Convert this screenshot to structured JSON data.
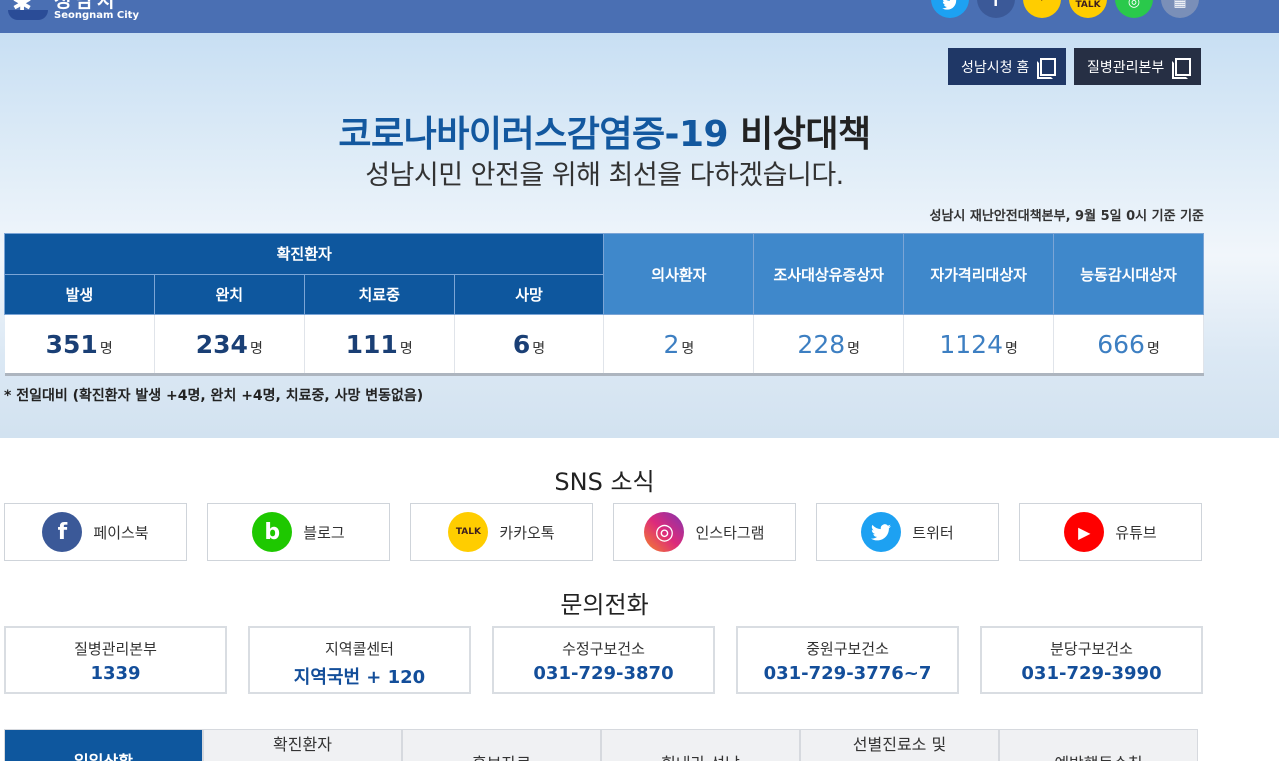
{
  "header": {
    "logo_ko": "성남시",
    "logo_en": "Seongnam City",
    "social_icons": [
      {
        "name": "twitter-icon",
        "glyph": "",
        "color": "#1da1f2"
      },
      {
        "name": "facebook-icon",
        "glyph": "f",
        "color": "#3b5998"
      },
      {
        "name": "kakaostory-icon",
        "glyph": "",
        "color": "#ffcd00"
      },
      {
        "name": "kakaotalk-icon",
        "glyph": "TALK",
        "color": "#ffcd00"
      },
      {
        "name": "band-icon",
        "glyph": "",
        "color": "#2ac94b"
      },
      {
        "name": "qrcode-icon",
        "glyph": "",
        "color": "#7a8fb8"
      }
    ]
  },
  "hero": {
    "btn_city_home": "성남시청 홈",
    "btn_kdca": "질병관리본부",
    "title_blue": "코로나바이러스감염증-19",
    "title_dark": "비상대책",
    "subtitle": "성남시민 안전을 위해 최선을 다하겠습니다.",
    "basis": "성남시 재난안전대책본부, 9월 5일 0시 기준 기준",
    "note": "* 전일대비 (확진환자 발생 +4명, 완치 +4명, 치료중, 사망 변동없음)"
  },
  "stats": {
    "confirmed_header": "확진환자",
    "sub_headers": [
      "발생",
      "완치",
      "치료중",
      "사망"
    ],
    "other_headers": [
      "의사환자",
      "조사대상유증상자",
      "자가격리대상자",
      "능동감시대상자"
    ],
    "confirmed_values": [
      "351",
      "234",
      "111",
      "6"
    ],
    "other_values": [
      "2",
      "228",
      "1124",
      "666"
    ],
    "unit": "명"
  },
  "sns": {
    "title": "SNS 소식",
    "items": [
      {
        "label": "페이스북",
        "icon": "facebook-icon",
        "glyph": "f",
        "color": "#3b5998"
      },
      {
        "label": "블로그",
        "icon": "blog-icon",
        "glyph": "b",
        "color": "#1ec800"
      },
      {
        "label": "카카오톡",
        "icon": "kakaotalk-icon",
        "glyph": "TALK",
        "color": "#ffcd00"
      },
      {
        "label": "인스타그램",
        "icon": "instagram-icon",
        "glyph": "◎",
        "color": "#c13584"
      },
      {
        "label": "트위터",
        "icon": "twitter-icon",
        "glyph": "",
        "color": "#1da1f2"
      },
      {
        "label": "유튜브",
        "icon": "youtube-icon",
        "glyph": "▶",
        "color": "#ff0000"
      }
    ]
  },
  "contact": {
    "title": "문의전화",
    "items": [
      {
        "name": "질병관리본부",
        "number": "1339"
      },
      {
        "name": "지역콜센터",
        "number": "지역국번 + 120"
      },
      {
        "name": "수정구보건소",
        "number": "031-729-3870"
      },
      {
        "name": "중원구보건소",
        "number": "031-729-3776~7"
      },
      {
        "name": "분당구보건소",
        "number": "031-729-3990"
      }
    ]
  },
  "tabs": [
    {
      "label": "일일상황",
      "active": true
    },
    {
      "label": "확진환자",
      "active": false
    },
    {
      "label": "홍보자료",
      "active": false
    },
    {
      "label": "힘내라 성남",
      "active": false
    },
    {
      "label": "선별진료소 및",
      "active": false
    },
    {
      "label": "예방행동수칙",
      "active": false
    }
  ]
}
